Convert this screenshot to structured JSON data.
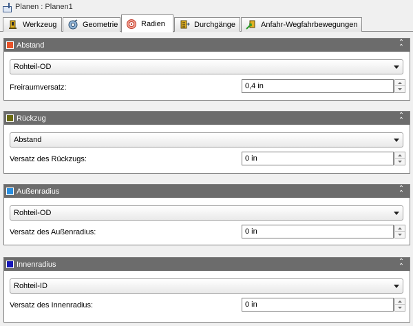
{
  "window": {
    "title": "Planen : Planen1"
  },
  "tabs": [
    {
      "label": "Werkzeug",
      "icon": "tool-icon",
      "active": false
    },
    {
      "label": "Geometrie",
      "icon": "geometry-icon",
      "active": false
    },
    {
      "label": "Radien",
      "icon": "radii-icon",
      "active": true
    },
    {
      "label": "Durchgänge",
      "icon": "passes-icon",
      "active": false
    },
    {
      "label": "Anfahr-Wegfahrbewegungen",
      "icon": "linking-icon",
      "active": false
    }
  ],
  "sections": {
    "abstand": {
      "title": "Abstand",
      "color": "#e8542a",
      "select_value": "Rohteil-OD",
      "field_label": "Freiraumversatz:",
      "field_value": "0,4 in"
    },
    "rueckzug": {
      "title": "Rückzug",
      "color": "#6b6b12",
      "select_value": "Abstand",
      "field_label": "Versatz des Rückzugs:",
      "field_value": "0 in"
    },
    "aussenradius": {
      "title": "Außenradius",
      "color": "#2a8fe0",
      "select_value": "Rohteil-OD",
      "field_label": "Versatz des Außenradius:",
      "field_value": "0 in"
    },
    "innenradius": {
      "title": "Innenradius",
      "color": "#1616b8",
      "select_value": "Rohteil-ID",
      "field_label": "Versatz des Innenradius:",
      "field_value": "0 in"
    }
  }
}
